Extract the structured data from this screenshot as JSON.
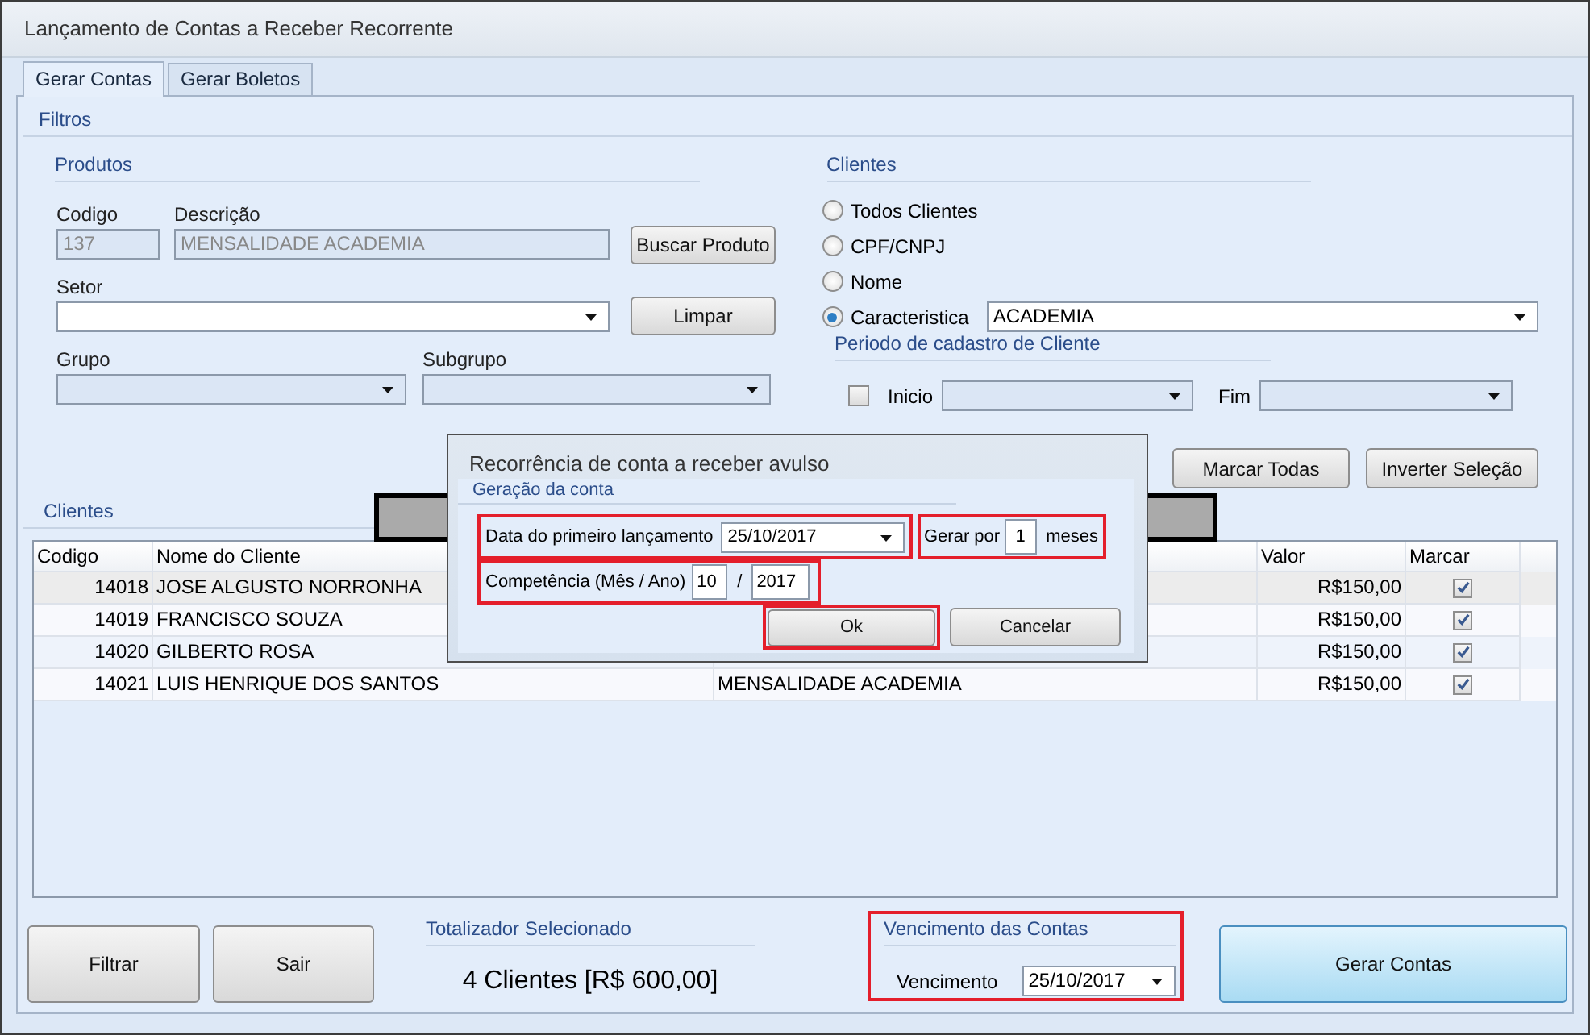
{
  "window": {
    "title": "Lançamento de Contas a Receber Recorrente"
  },
  "tabs": [
    {
      "label": "Gerar Contas",
      "selected": true
    },
    {
      "label": "Gerar Boletos",
      "selected": false
    }
  ],
  "filters": {
    "title": "Filtros",
    "produtos": {
      "title": "Produtos",
      "codigo": {
        "label": "Codigo",
        "value": "137",
        "disabled": true
      },
      "descricao": {
        "label": "Descrição",
        "value": "MENSALIDADE ACADEMIA",
        "disabled": true
      },
      "setor": {
        "label": "Setor"
      },
      "grupo": {
        "label": "Grupo"
      },
      "subgrupo": {
        "label": "Subgrupo"
      },
      "search_button": "Buscar Produto",
      "clear_button": "Limpar"
    },
    "clientes": {
      "title": "Clientes",
      "options": [
        {
          "label": "Todos Clientes",
          "selected": false,
          "kind": "radio"
        },
        {
          "label": "CPF/CNPJ",
          "selected": false,
          "kind": "radio"
        },
        {
          "label": "Nome",
          "selected": false,
          "kind": "radio"
        },
        {
          "label": "Caracteristica",
          "selected": true,
          "kind": "radio_select",
          "value": "ACADEMIA"
        }
      ]
    },
    "periodo": {
      "title": "Periodo de cadastro de Cliente",
      "checked": false,
      "inicio_label": "Inicio",
      "fim_label": "Fim"
    }
  },
  "selection_buttons": [
    "Marcar Todas",
    "Inverter Seleção"
  ],
  "clients": {
    "title": "Clientes",
    "columns": {
      "codigo": "Codigo",
      "nome": "Nome do Cliente",
      "valor": "Valor",
      "marcar": "Marcar"
    },
    "rows": [
      {
        "codigo": "14018",
        "nome": "JOSE ALGUSTO NORRONHA",
        "valor": "R$150,00",
        "marcar": true,
        "selected": true
      },
      {
        "codigo": "14019",
        "nome": "FRANCISCO SOUZA",
        "valor": "R$150,00",
        "marcar": true,
        "selected": false
      },
      {
        "codigo": "14020",
        "nome": "GILBERTO ROSA",
        "valor": "R$150,00",
        "marcar": true,
        "selected": false
      },
      {
        "codigo": "14021",
        "nome": "LUIS HENRIQUE DOS SANTOS",
        "column_3": "MENSALIDADE ACADEMIA",
        "valor": "R$150,00",
        "marcar": true,
        "selected": false
      }
    ]
  },
  "actions": [
    "Filtrar",
    "Sair"
  ],
  "totalizador": {
    "title": "Totalizador Selecionado",
    "value": "4 Clientes [R$ 600,00]"
  },
  "vencimento": {
    "title": "Vencimento das Contas",
    "label": "Vencimento",
    "value": "25/10/2017",
    "highlighted": true
  },
  "generate_button": "Gerar Contas",
  "dialog": {
    "title": "Recorrência de conta a receber avulso",
    "group_title": "Geração da conta",
    "first_date": {
      "label": "Data do primeiro lançamento",
      "value": "25/10/2017",
      "highlighted": true
    },
    "gerar_por": {
      "label": "Gerar por",
      "value": "1",
      "unit": "meses",
      "highlighted": true
    },
    "competencia": {
      "label": "Competência (Mês / Ano)",
      "mes": "10",
      "separator": "/",
      "ano": "2017",
      "highlighted": true
    },
    "ok": {
      "label": "Ok",
      "highlighted": true
    },
    "cancel": {
      "label": "Cancelar"
    }
  }
}
